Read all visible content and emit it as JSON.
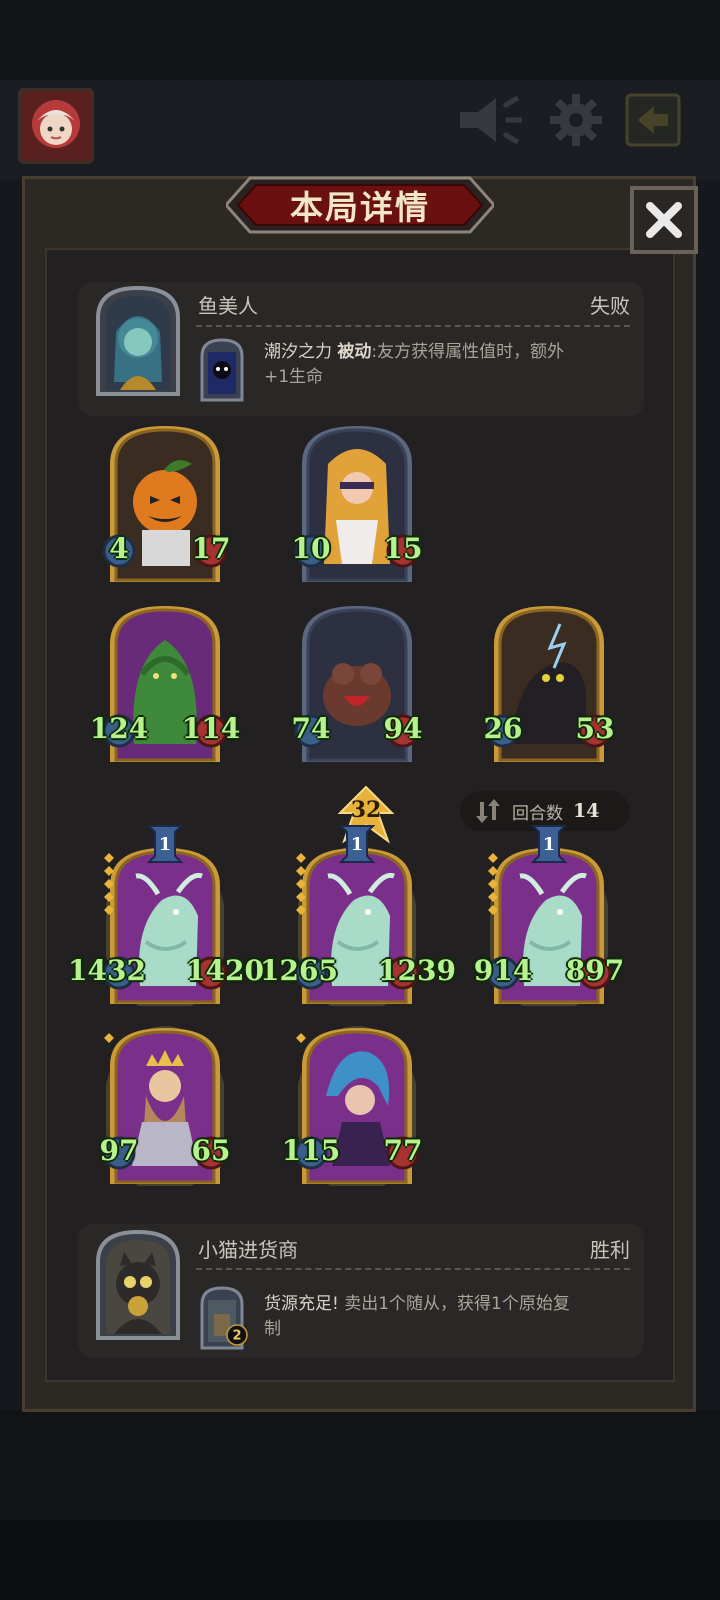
{
  "screen": {
    "title": "本局详情"
  },
  "top_player": {
    "name": "鱼美人",
    "result": "失败",
    "skill_name": "潮汐之力",
    "skill_type": "被动",
    "skill_desc": ":友方获得属性值时，额外",
    "skill_desc2": "+1生命"
  },
  "bottom_player": {
    "name": "小猫进货商",
    "result": "胜利",
    "skill_name": "货源充足!",
    "skill_desc": " 卖出1个随从，获得1个原始复",
    "skill_desc2": "制",
    "skill_badge": "2"
  },
  "turns": {
    "label": "回合数",
    "value": "14"
  },
  "upgrade_arrow": {
    "value": "32"
  },
  "opponent_units": [
    {
      "attack": "4",
      "health": "17",
      "portrait": "pumpkin",
      "frame": "gold"
    },
    {
      "attack": "10",
      "health": "15",
      "portrait": "blindfold-lady",
      "frame": "silver"
    },
    {
      "attack": "124",
      "health": "114",
      "portrait": "bush-creature",
      "frame": "gold"
    },
    {
      "attack": "74",
      "health": "94",
      "portrait": "hound",
      "frame": "silver"
    },
    {
      "attack": "26",
      "health": "53",
      "portrait": "panther",
      "frame": "gold"
    }
  ],
  "player_units": [
    {
      "attack": "1432",
      "health": "1420",
      "level": "1",
      "portrait": "goat-spirit"
    },
    {
      "attack": "1265",
      "health": "1239",
      "level": "1",
      "portrait": "goat-spirit"
    },
    {
      "attack": "914",
      "health": "897",
      "level": "1",
      "portrait": "goat-spirit"
    },
    {
      "attack": "97",
      "health": "65",
      "portrait": "king"
    },
    {
      "attack": "115",
      "health": "77",
      "portrait": "blue-hair-elf"
    }
  ],
  "icons": {
    "avatar": "avatar-icon",
    "megaphone": "megaphone-icon",
    "settings": "gear-icon",
    "exit": "exit-icon",
    "close": "close-icon",
    "turns": "cycle-icon"
  },
  "colors": {
    "stat_text": "#b8f28e",
    "title_banner": "#6b1010",
    "gold_frame": "#c99a3a",
    "silver_frame": "#5b6780"
  }
}
